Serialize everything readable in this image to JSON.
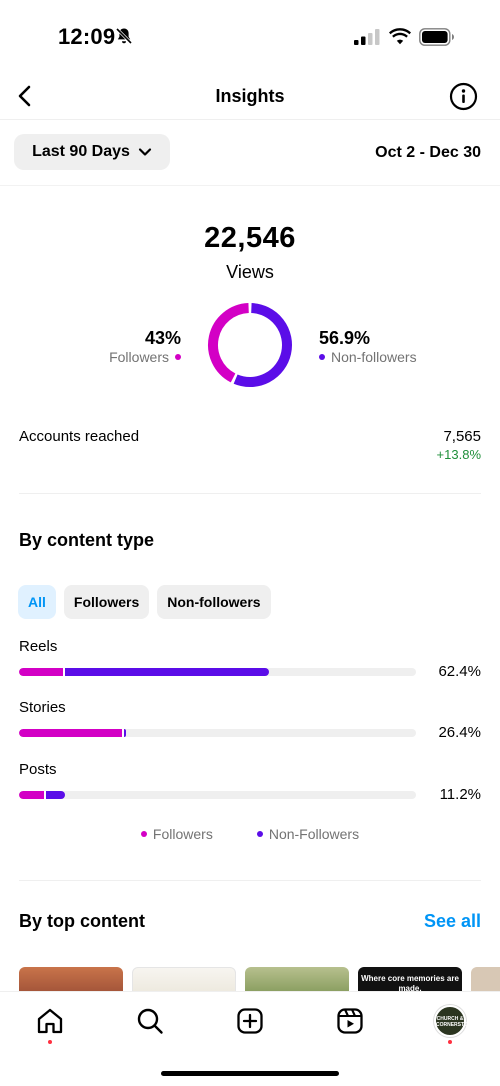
{
  "status_bar": {
    "time": "12:09",
    "icons": [
      "bell-slash-icon",
      "cellular-signal-icon",
      "wifi-icon",
      "battery-icon"
    ]
  },
  "header": {
    "title": "Insights",
    "back_icon": "chevron-left-icon",
    "info_icon": "info-circle-icon"
  },
  "filter": {
    "range_label": "Last 90 Days",
    "date_range": "Oct 2 - Dec 30"
  },
  "views": {
    "total": "22,546",
    "label": "Views",
    "followers_pct": "43%",
    "followers_label": "Followers",
    "followers_fraction": 0.43,
    "non_followers_pct": "56.9%",
    "non_followers_label": "Non-followers",
    "non_followers_fraction": 0.569
  },
  "accounts_reached": {
    "label": "Accounts reached",
    "value": "7,565",
    "change": "+13.8%"
  },
  "content_type": {
    "title": "By content type",
    "chips": [
      {
        "label": "All",
        "active": true
      },
      {
        "label": "Followers",
        "active": false
      },
      {
        "label": "Non-followers",
        "active": false
      }
    ],
    "rows": [
      {
        "label": "Reels",
        "pct": "62.4%",
        "followers_fraction": 0.11,
        "non_followers_fraction": 0.514
      },
      {
        "label": "Stories",
        "pct": "26.4%",
        "followers_fraction": 0.26,
        "non_followers_fraction": 0.004
      },
      {
        "label": "Posts",
        "pct": "11.2%",
        "followers_fraction": 0.062,
        "non_followers_fraction": 0.05
      }
    ],
    "legend": {
      "followers": "Followers",
      "non_followers": "Non-Followers"
    }
  },
  "top_content": {
    "title": "By top content",
    "see_all": "See all",
    "thumb_4_text": "Where core memories are made.",
    "avatar_text": "CHURCH & CORNERSTONE"
  },
  "colors": {
    "followers": "#d300c5",
    "non_followers": "#5b0de8",
    "accent": "#0095f6",
    "positive": "#1f8f3a"
  },
  "tabbar": {
    "items": [
      "home-icon",
      "search-icon",
      "create-plus-icon",
      "reels-icon",
      "profile-avatar"
    ]
  }
}
